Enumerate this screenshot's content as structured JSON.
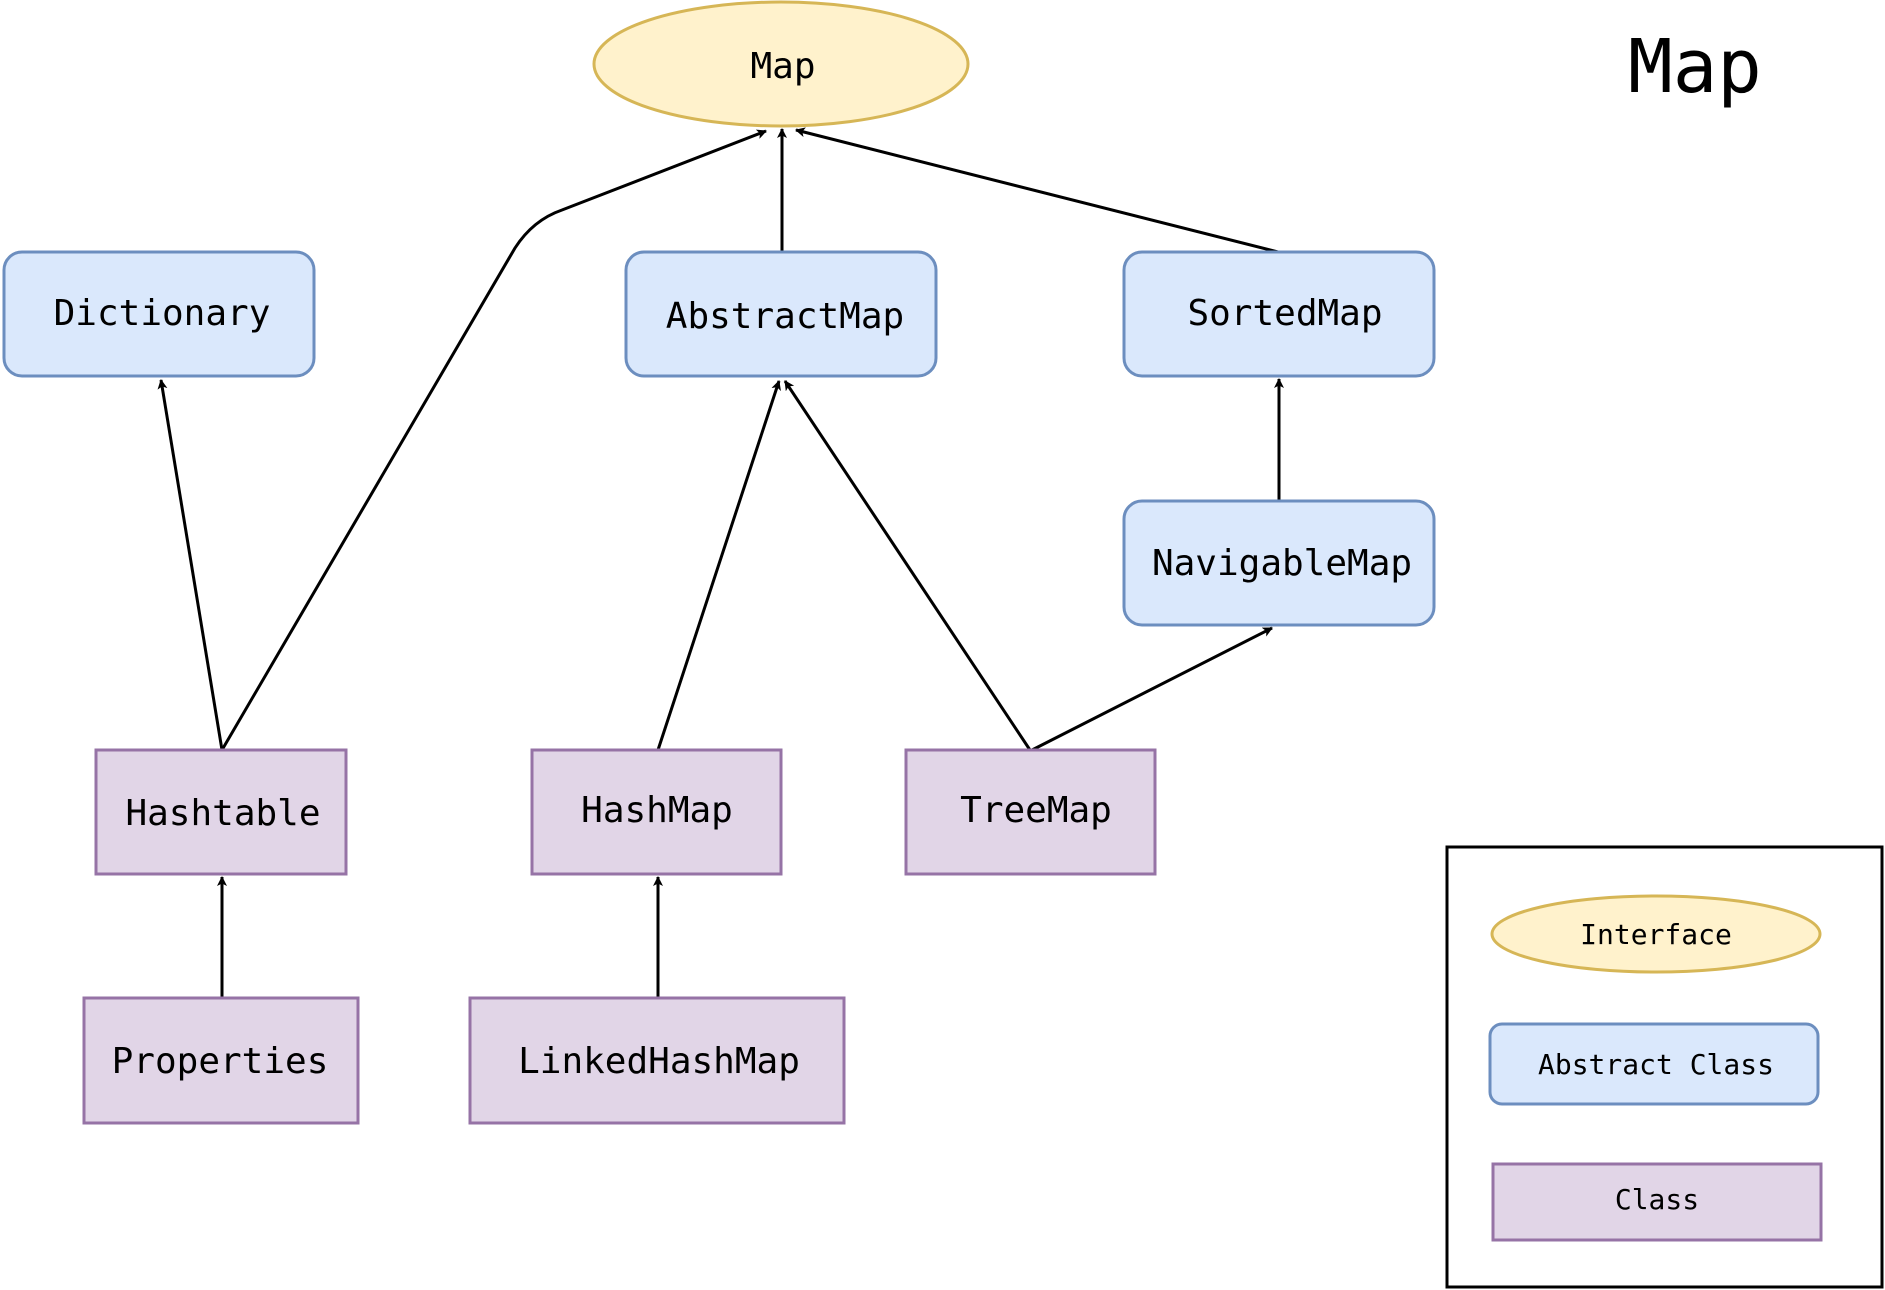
{
  "title": "Map",
  "colors": {
    "interface_fill": "#fff2cc",
    "interface_stroke": "#d6b656",
    "abstract_fill": "#dae8fc",
    "abstract_stroke": "#6c8ebf",
    "class_fill": "#e1d5e7",
    "class_stroke": "#9673a6",
    "edge": "#000000"
  },
  "nodes": [
    {
      "id": "map",
      "label": "Map",
      "kind": "interface"
    },
    {
      "id": "dictionary",
      "label": "Dictionary",
      "kind": "abstract"
    },
    {
      "id": "abstractmap",
      "label": "AbstractMap",
      "kind": "abstract"
    },
    {
      "id": "sortedmap",
      "label": "SortedMap",
      "kind": "abstract"
    },
    {
      "id": "navigablemap",
      "label": "NavigableMap",
      "kind": "abstract"
    },
    {
      "id": "hashtable",
      "label": "Hashtable",
      "kind": "class"
    },
    {
      "id": "hashmap",
      "label": "HashMap",
      "kind": "class"
    },
    {
      "id": "treemap",
      "label": "TreeMap",
      "kind": "class"
    },
    {
      "id": "properties",
      "label": "Properties",
      "kind": "class"
    },
    {
      "id": "linkedhashmap",
      "label": "LinkedHashMap",
      "kind": "class"
    }
  ],
  "edges": [
    {
      "from": "hashtable",
      "to": "dictionary"
    },
    {
      "from": "hashtable",
      "to": "map"
    },
    {
      "from": "abstractmap",
      "to": "map"
    },
    {
      "from": "sortedmap",
      "to": "map"
    },
    {
      "from": "navigablemap",
      "to": "sortedmap"
    },
    {
      "from": "hashmap",
      "to": "abstractmap"
    },
    {
      "from": "treemap",
      "to": "abstractmap"
    },
    {
      "from": "treemap",
      "to": "navigablemap"
    },
    {
      "from": "properties",
      "to": "hashtable"
    },
    {
      "from": "linkedhashmap",
      "to": "hashmap"
    }
  ],
  "legend": {
    "items": [
      {
        "label": "Interface",
        "kind": "interface"
      },
      {
        "label": "Abstract Class",
        "kind": "abstract"
      },
      {
        "label": "Class",
        "kind": "class"
      }
    ]
  }
}
